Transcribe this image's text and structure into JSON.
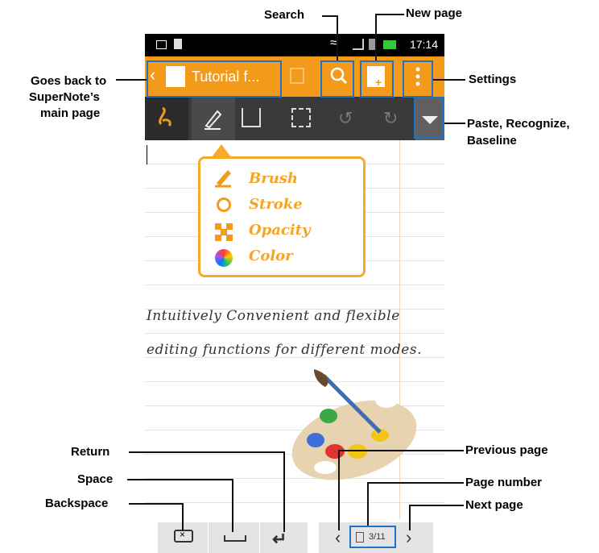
{
  "annotations": {
    "search": "Search",
    "new_page": "New page",
    "goes_back_line1": "Goes back to",
    "goes_back_line2": "SuperNote’s",
    "goes_back_line3": "main page",
    "settings": "Settings",
    "paste_line1": "Paste, Recognize,",
    "paste_line2": "Baseline",
    "return": "Return",
    "space": "Space",
    "backspace": "Backspace",
    "previous_page": "Previous page",
    "page_number": "Page number",
    "next_page": "Next page"
  },
  "status_bar": {
    "time": "17:14"
  },
  "action_bar": {
    "title": "Tutorial f..."
  },
  "tooltip": {
    "items": [
      {
        "label": "Brush",
        "icon": "brush-icon"
      },
      {
        "label": "Stroke",
        "icon": "stroke-icon"
      },
      {
        "label": "Opacity",
        "icon": "opacity-icon"
      },
      {
        "label": "Color",
        "icon": "color-icon"
      }
    ]
  },
  "note": {
    "line1": "Intuitively Convenient and flexible",
    "line2": "editing functions for different modes."
  },
  "pager": {
    "page_number": "3/11"
  },
  "colors": {
    "accent": "#f39a1a",
    "highlight": "#1e73c8",
    "toolbar": "#3a3a3a"
  }
}
